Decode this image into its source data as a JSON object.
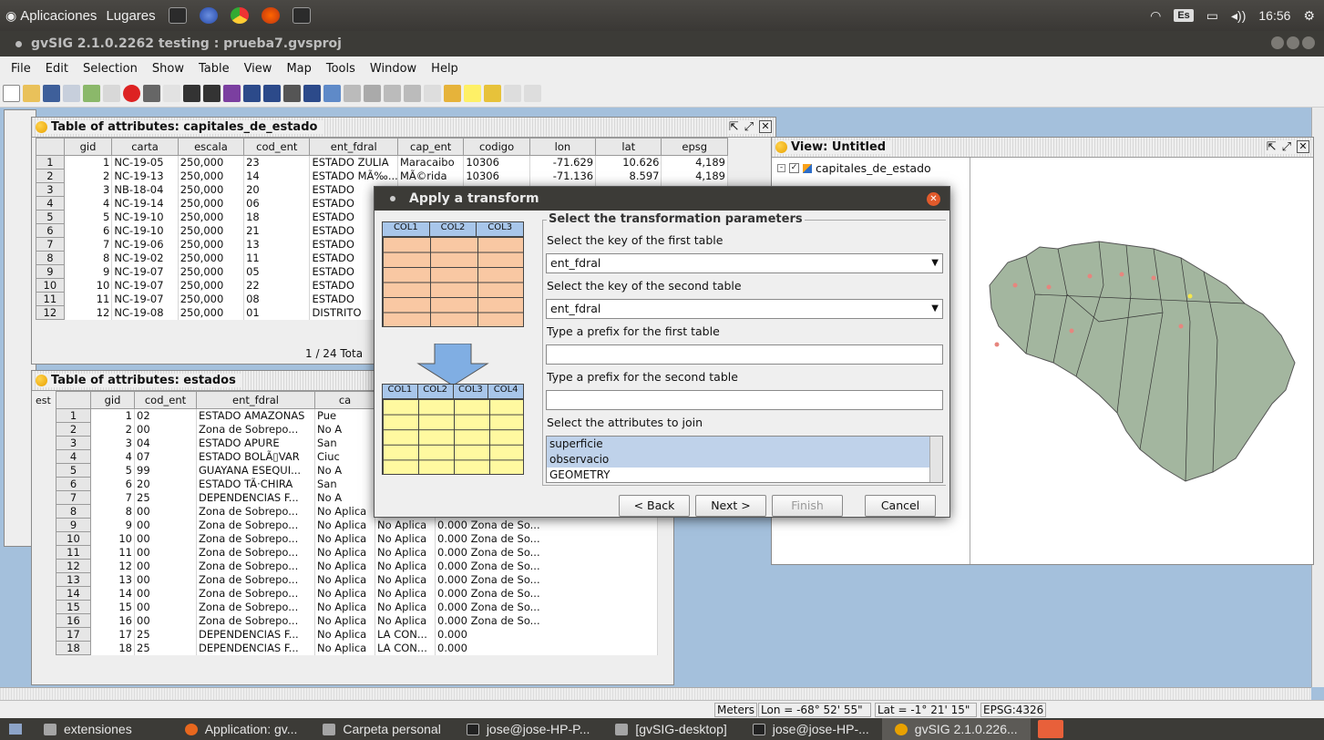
{
  "top_panel": {
    "menu_apps": "Aplicaciones",
    "menu_places": "Lugares",
    "keyboard_layout": "Es",
    "clock": "16:56"
  },
  "window": {
    "title": "gvSIG 2.1.0.2262 testing : prueba7.gvsproj"
  },
  "menubar": [
    "File",
    "Edit",
    "Selection",
    "Show",
    "Table",
    "View",
    "Map",
    "Tools",
    "Window",
    "Help"
  ],
  "table1": {
    "title": "Table of attributes: capitales_de_estado",
    "columns": [
      "gid",
      "carta",
      "escala",
      "cod_ent",
      "ent_fdral",
      "cap_ent",
      "codigo",
      "lon",
      "lat",
      "epsg"
    ],
    "rows": [
      [
        "1",
        "NC-19-05",
        "250,000",
        "23",
        "ESTADO ZULIA",
        "Maracaibo",
        "10306",
        "-71.629",
        "10.626",
        "4,189"
      ],
      [
        "2",
        "NC-19-13",
        "250,000",
        "14",
        "ESTADO MÃ‰...",
        "MÃ©rida",
        "10306",
        "-71.136",
        "8.597",
        "4,189"
      ],
      [
        "3",
        "NB-18-04",
        "250,000",
        "20",
        "ESTADO",
        "",
        "",
        "",
        "",
        ""
      ],
      [
        "4",
        "NC-19-14",
        "250,000",
        "06",
        "ESTADO",
        "",
        "",
        "",
        "",
        ""
      ],
      [
        "5",
        "NC-19-10",
        "250,000",
        "18",
        "ESTADO",
        "",
        "",
        "",
        "",
        ""
      ],
      [
        "6",
        "NC-19-10",
        "250,000",
        "21",
        "ESTADO",
        "",
        "",
        "",
        "",
        ""
      ],
      [
        "7",
        "NC-19-06",
        "250,000",
        "13",
        "ESTADO",
        "",
        "",
        "",
        "",
        ""
      ],
      [
        "8",
        "NC-19-02",
        "250,000",
        "11",
        "ESTADO",
        "",
        "",
        "",
        "",
        ""
      ],
      [
        "9",
        "NC-19-07",
        "250,000",
        "05",
        "ESTADO",
        "",
        "",
        "",
        "",
        ""
      ],
      [
        "10",
        "NC-19-07",
        "250,000",
        "22",
        "ESTADO",
        "",
        "",
        "",
        "",
        ""
      ],
      [
        "11",
        "NC-19-07",
        "250,000",
        "08",
        "ESTADO",
        "",
        "",
        "",
        "",
        ""
      ],
      [
        "12",
        "NC-19-08",
        "250,000",
        "01",
        "DISTRITO",
        "",
        "",
        "",
        "",
        ""
      ]
    ],
    "footer": "1 / 24 Tota"
  },
  "table2": {
    "title": "Table of attributes: estados",
    "side_label": "est",
    "columns": [
      "gid",
      "cod_ent",
      "ent_fdral",
      "ca",
      "",
      ""
    ],
    "rows": [
      [
        "1",
        "02",
        "ESTADO AMAZONAS",
        "Pue",
        "",
        ""
      ],
      [
        "2",
        "00",
        "Zona de Sobrepo...",
        "No A",
        "",
        ""
      ],
      [
        "3",
        "04",
        "ESTADO APURE",
        "San",
        "",
        ""
      ],
      [
        "4",
        "07",
        "ESTADO BOLÃ▯VAR",
        "Ciuc",
        "",
        ""
      ],
      [
        "5",
        "99",
        "GUAYANA ESEQUI...",
        "No A",
        "",
        ""
      ],
      [
        "6",
        "20",
        "ESTADO TÃ·CHIRA",
        "San",
        "",
        ""
      ],
      [
        "7",
        "25",
        "DEPENDENCIAS F...",
        "No A",
        "",
        ""
      ],
      [
        "8",
        "00",
        "Zona de Sobrepo...",
        "No Aplica",
        "No Aplica",
        "0.000 Zona de So..."
      ],
      [
        "9",
        "00",
        "Zona de Sobrepo...",
        "No Aplica",
        "No Aplica",
        "0.000 Zona de So..."
      ],
      [
        "10",
        "00",
        "Zona de Sobrepo...",
        "No Aplica",
        "No Aplica",
        "0.000 Zona de So..."
      ],
      [
        "11",
        "00",
        "Zona de Sobrepo...",
        "No Aplica",
        "No Aplica",
        "0.000 Zona de So..."
      ],
      [
        "12",
        "00",
        "Zona de Sobrepo...",
        "No Aplica",
        "No Aplica",
        "0.000 Zona de So..."
      ],
      [
        "13",
        "00",
        "Zona de Sobrepo...",
        "No Aplica",
        "No Aplica",
        "0.000 Zona de So..."
      ],
      [
        "14",
        "00",
        "Zona de Sobrepo...",
        "No Aplica",
        "No Aplica",
        "0.000 Zona de So..."
      ],
      [
        "15",
        "00",
        "Zona de Sobrepo...",
        "No Aplica",
        "No Aplica",
        "0.000 Zona de So..."
      ],
      [
        "16",
        "00",
        "Zona de Sobrepo...",
        "No Aplica",
        "No Aplica",
        "0.000 Zona de So..."
      ],
      [
        "17",
        "25",
        "DEPENDENCIAS F...",
        "No Aplica",
        "LA CON...",
        "0.000"
      ],
      [
        "18",
        "25",
        "DEPENDENCIAS F...",
        "No Aplica",
        "LA CON...",
        "0.000"
      ]
    ]
  },
  "view": {
    "title": "View: Untitled",
    "layer": "capitales_de_estado"
  },
  "dialog": {
    "title": "Apply a transform",
    "group_title": "Select the transformation parameters",
    "label_key1": "Select the key of the first table",
    "key1_value": "ent_fdral",
    "label_key2": "Select the key of the second table",
    "key2_value": "ent_fdral",
    "label_prefix1": "Type a prefix for the first table",
    "label_prefix2": "Type a prefix for the second table",
    "label_attrs": "Select the attributes to join",
    "attrs": [
      "superficie",
      "observacio",
      "GEOMETRY"
    ],
    "diagram_cols_top": [
      "COL1",
      "COL2",
      "COL3"
    ],
    "diagram_cols_bottom": [
      "COL1",
      "COL2",
      "COL3",
      "COL4"
    ],
    "btn_back": "< Back",
    "btn_next": "Next >",
    "btn_finish": "Finish",
    "btn_cancel": "Cancel"
  },
  "statusbar": {
    "units": "Meters",
    "lon": "Lon = -68° 52' 55\"",
    "lat": "Lat = -1° 21' 15\"",
    "epsg": "EPSG:4326"
  },
  "taskbar": [
    "extensiones",
    "Application: gv...",
    "Carpeta personal",
    "jose@jose-HP-P...",
    "[gvSIG-desktop]",
    "jose@jose-HP-...",
    "gvSIG 2.1.0.226..."
  ],
  "colors": {
    "accent_orange": "#f9c8a3",
    "accent_yellow": "#fff9a0",
    "map_land": "#a3b69f",
    "close_red": "#e15a2b"
  }
}
